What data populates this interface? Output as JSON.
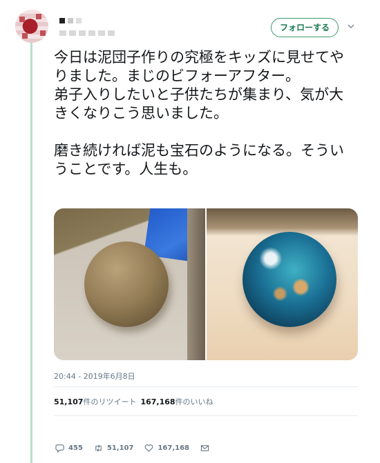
{
  "header": {
    "follow_label": "フォローする"
  },
  "tweet": {
    "text": "今日は泥団子作りの究極をキッズに見せてやりました。まじのビフォーアフター。\n弟子入りしたいと子供たちが集まり、気が大きくなりこう思いました。\n\n磨き続ければ泥も宝石のようになる。そういうことです。人生も。",
    "timestamp": "20:44 - 2019年6月8日"
  },
  "stats": {
    "retweets": "51,107",
    "retweets_label": "件のリツイート",
    "likes": "167,168",
    "likes_label": "件のいいね"
  },
  "actions": {
    "replies": "455",
    "retweets": "51,107",
    "likes": "167,168"
  },
  "icons": {
    "reply": "reply-icon",
    "retweet": "retweet-icon",
    "like": "heart-icon",
    "dm": "envelope-icon",
    "caret": "chevron-down-icon"
  },
  "colors": {
    "thread_line": "#b8e0c8",
    "follow_accent": "#1a7a50",
    "meta_text": "#657786"
  }
}
